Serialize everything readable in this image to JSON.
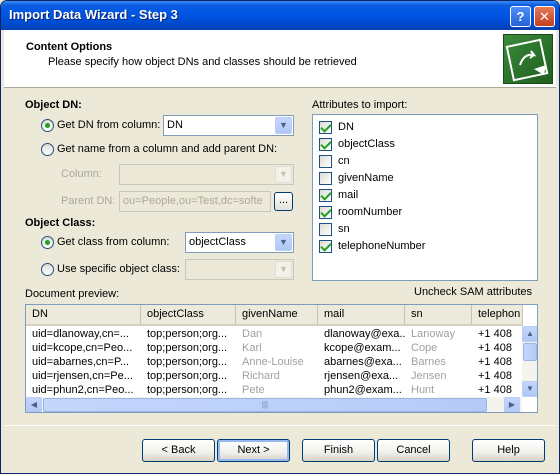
{
  "window": {
    "title": "Import Data Wizard - Step 3",
    "help_btn": "?",
    "close_btn": "✕"
  },
  "header": {
    "title": "Content Options",
    "subtitle": "Please specify how object DNs and classes should be retrieved",
    "logo_icon": "import-wizard-icon"
  },
  "object_dn": {
    "label": "Object DN:",
    "opt_from_column": "Get DN from column:",
    "from_column_value": "DN",
    "opt_name_parent": "Get name from a column and add parent DN:",
    "column_label": "Column:",
    "column_value": "",
    "parent_dn_label": "Parent DN:",
    "parent_dn_value": "ou=People,ou=Test,dc=softe",
    "browse_label": "..."
  },
  "object_class": {
    "label": "Object Class:",
    "opt_from_column": "Get class from column:",
    "from_column_value": "objectClass",
    "opt_specific": "Use specific object class:",
    "specific_value": ""
  },
  "attributes": {
    "label": "Attributes to import:",
    "items": [
      {
        "name": "DN",
        "checked": true
      },
      {
        "name": "objectClass",
        "checked": true
      },
      {
        "name": "cn",
        "checked": false
      },
      {
        "name": "givenName",
        "checked": false
      },
      {
        "name": "mail",
        "checked": true
      },
      {
        "name": "roomNumber",
        "checked": true
      },
      {
        "name": "sn",
        "checked": false
      },
      {
        "name": "telephoneNumber",
        "checked": true
      }
    ]
  },
  "preview": {
    "label": "Document preview:",
    "uncheck_label": "Uncheck SAM attributes",
    "columns": [
      "DN",
      "objectClass",
      "givenName",
      "mail",
      "sn",
      "telephon"
    ],
    "rows": [
      [
        "uid=dlanoway,cn=...",
        "top;person;org...",
        "Dan",
        "dlanoway@exa...",
        "Lanoway",
        "+1 408"
      ],
      [
        "uid=kcope,cn=Peo...",
        "top;person;org...",
        "Karl",
        "kcope@exam...",
        "Cope",
        "+1 408"
      ],
      [
        "uid=abarnes,cn=P...",
        "top;person;org...",
        "Anne-Louise",
        "abarnes@exa...",
        "Barnes",
        "+1 408"
      ],
      [
        "uid=rjensen,cn=Pe...",
        "top;person;org...",
        "Richard",
        "rjensen@exa...",
        "Jensen",
        "+1 408"
      ],
      [
        "uid=phun2,cn=Peo...",
        "top;person;org...",
        "Pete",
        "phun2@exam...",
        "Hunt",
        "+1 408"
      ]
    ]
  },
  "buttons": {
    "back": "< Back",
    "next": "Next >",
    "finish": "Finish",
    "cancel": "Cancel",
    "help": "Help"
  }
}
